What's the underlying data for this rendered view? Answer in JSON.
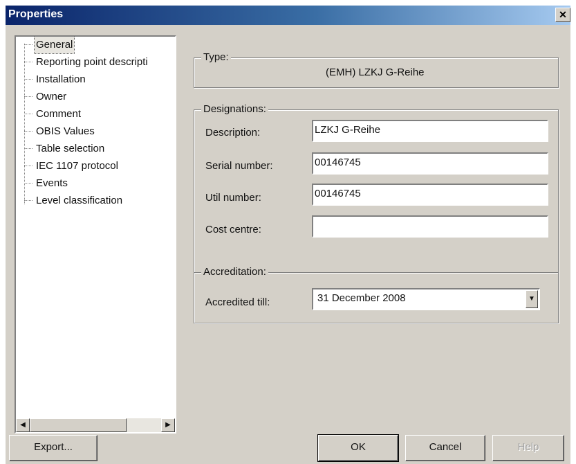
{
  "window": {
    "title": "Properties",
    "close_glyph": "✕"
  },
  "tree": {
    "items": [
      {
        "label": "General",
        "selected": true
      },
      {
        "label": "Reporting point descripti"
      },
      {
        "label": "Installation"
      },
      {
        "label": "Owner"
      },
      {
        "label": "Comment"
      },
      {
        "label": "OBIS Values"
      },
      {
        "label": "Table selection"
      },
      {
        "label": "IEC 1107 protocol"
      },
      {
        "label": "Events"
      },
      {
        "label": "Level classification"
      }
    ],
    "scroll_left_glyph": "◀",
    "scroll_right_glyph": "▶"
  },
  "type_group": {
    "title": "Type:",
    "value": "(EMH) LZKJ G-Reihe"
  },
  "designations": {
    "title": "Designations:",
    "description_label": "Description:",
    "description_value": "LZKJ G-Reihe",
    "serial_label": "Serial number:",
    "serial_value": "00146745",
    "util_label": "Util number:",
    "util_value": "00146745",
    "cost_label": "Cost centre:",
    "cost_value": ""
  },
  "accreditation": {
    "title": "Accreditation:",
    "accredited_label": "Accredited till:",
    "accredited_value": "31 December 2008",
    "dropdown_glyph": "▼"
  },
  "buttons": {
    "export": "Export...",
    "ok": "OK",
    "cancel": "Cancel",
    "help": "Help"
  }
}
